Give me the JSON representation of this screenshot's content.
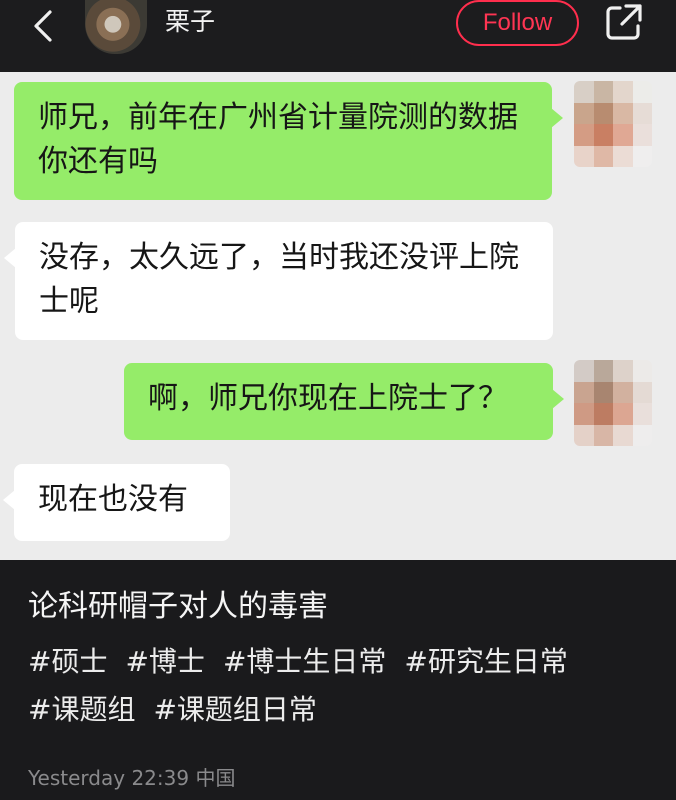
{
  "header": {
    "username": "栗子",
    "follow_label": "Follow",
    "icons": {
      "back": "chevron-left-icon",
      "share": "share-icon"
    },
    "colors": {
      "follow": "#ff3553",
      "background": "#1c1c1e"
    }
  },
  "chat": {
    "background": "#ececec",
    "messages": [
      {
        "side": "right",
        "text": "师兄，前年在广州省计量院测的数据你还有吗"
      },
      {
        "side": "left",
        "text": "没存，太久远了，当时我还没评上院士呢"
      },
      {
        "side": "right",
        "text": "啊，师兄你现在上院士了？"
      },
      {
        "side": "left",
        "text": "现在也没有"
      }
    ],
    "colors": {
      "sent_bubble": "#95ec69",
      "received_bubble": "#ffffff"
    }
  },
  "post": {
    "title": "论科研帽子对人的毒害",
    "tags": [
      "#硕士",
      "#博士",
      "#博士生日常",
      "#研究生日常",
      "#课题组",
      "#课题组日常"
    ],
    "timestamp": "Yesterday 22:39",
    "location": "中国"
  }
}
